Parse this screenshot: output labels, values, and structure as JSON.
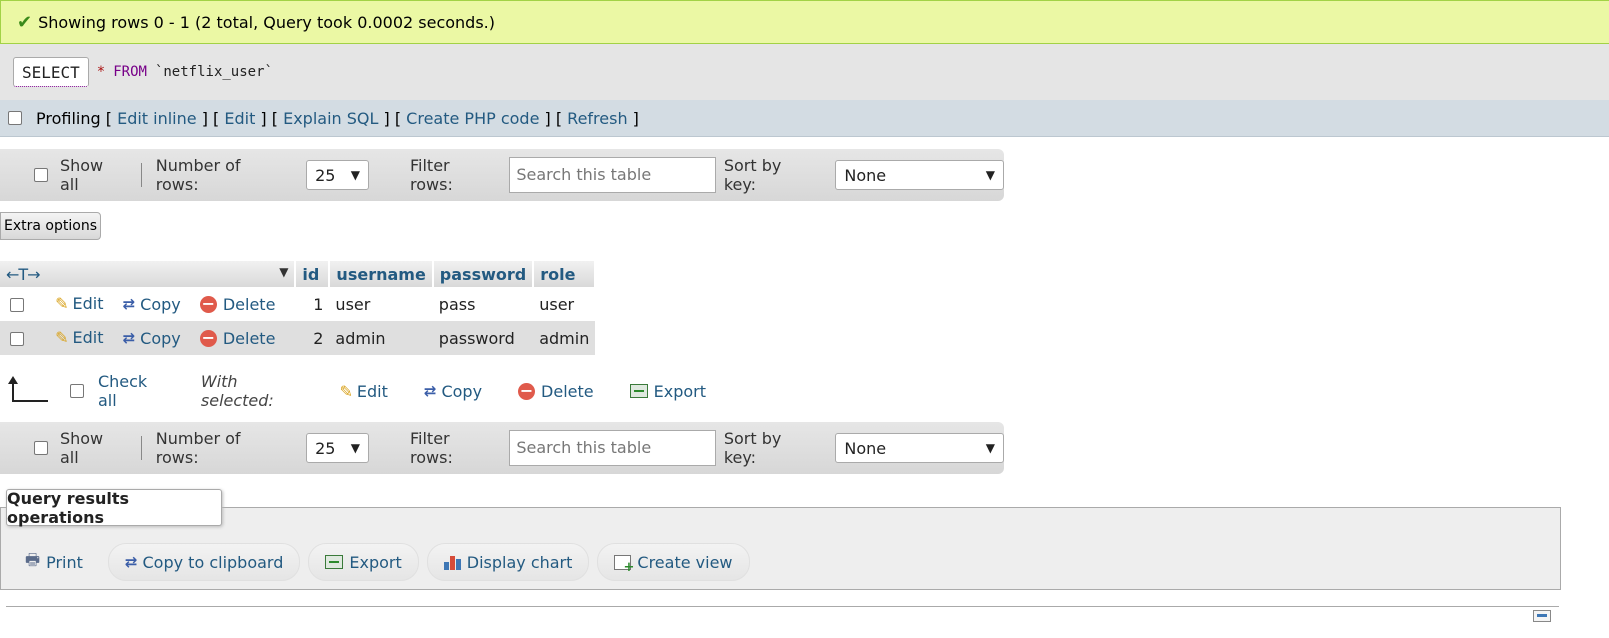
{
  "success": {
    "message": "Showing rows 0 - 1 (2 total, Query took 0.0002 seconds.)"
  },
  "sql": {
    "select_kw": "SELECT",
    "star": "*",
    "from_kw": "FROM",
    "table": "`netflix_user`"
  },
  "profiling": {
    "label": "Profiling",
    "links": [
      "Edit inline",
      "Edit",
      "Explain SQL",
      "Create PHP code",
      "Refresh"
    ]
  },
  "nav": {
    "show_all": "Show all",
    "rows_label": "Number of rows:",
    "rows_value": "25",
    "filter_label": "Filter rows:",
    "filter_placeholder": "Search this table",
    "sort_label": "Sort by key:",
    "sort_value": "None"
  },
  "extra_options": "Extra options",
  "table": {
    "arrows": "←T→",
    "columns": [
      "id",
      "username",
      "password",
      "role"
    ],
    "actions": {
      "edit": "Edit",
      "copy": "Copy",
      "delete": "Delete"
    },
    "rows": [
      {
        "id": "1",
        "username": "user",
        "password": "pass",
        "role": "user"
      },
      {
        "id": "2",
        "username": "admin",
        "password": "password",
        "role": "admin"
      }
    ]
  },
  "with_selected": {
    "check_all": "Check all",
    "label": "With selected:",
    "edit": "Edit",
    "copy": "Copy",
    "delete": "Delete",
    "export": "Export"
  },
  "query_ops": {
    "legend": "Query results operations",
    "print": "Print",
    "copy_clipboard": "Copy to clipboard",
    "export": "Export",
    "display_chart": "Display chart",
    "create_view": "Create view"
  },
  "icons": {
    "success": "check-icon",
    "edit": "pencil-icon",
    "copy": "copy-icon",
    "delete": "delete-icon",
    "export": "export-icon",
    "print": "print-icon",
    "chart": "chart-icon",
    "view": "create-view-icon"
  },
  "colors": {
    "success_bg": "#ebf8a4",
    "link": "#235a81",
    "profiling_bg": "#d3dce3"
  }
}
